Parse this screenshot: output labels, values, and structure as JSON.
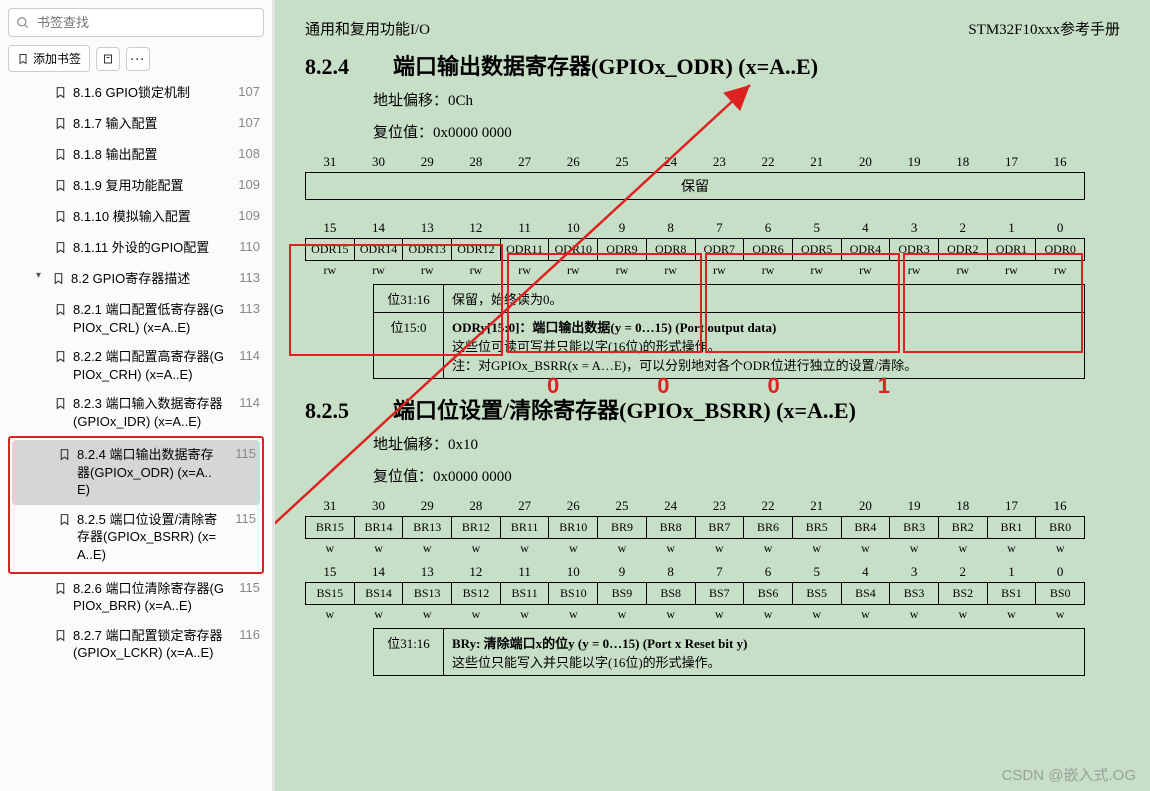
{
  "sidebar": {
    "search_placeholder": "书签查找",
    "add_bookmark": "添加书签",
    "items": [
      {
        "label": "8.1.6 GPIO锁定机制",
        "page": "107",
        "indent": 2
      },
      {
        "label": "8.1.7 输入配置",
        "page": "107",
        "indent": 2
      },
      {
        "label": "8.1.8 输出配置",
        "page": "108",
        "indent": 2
      },
      {
        "label": "8.1.9 复用功能配置",
        "page": "109",
        "indent": 2
      },
      {
        "label": "8.1.10 模拟输入配置",
        "page": "109",
        "indent": 2
      },
      {
        "label": "8.1.11 外设的GPIO配置",
        "page": "110",
        "indent": 2
      },
      {
        "label": "8.2 GPIO寄存器描述",
        "page": "113",
        "indent": 1,
        "caret": "▾"
      },
      {
        "label": "8.2.1 端口配置低寄存器(GPIOx_CRL) (x=A..E)",
        "page": "113",
        "indent": 2
      },
      {
        "label": "8.2.2 端口配置高寄存器(GPIOx_CRH) (x=A..E)",
        "page": "114",
        "indent": 2
      },
      {
        "label": "8.2.3 端口输入数据寄存器(GPIOx_IDR) (x=A..E)",
        "page": "114",
        "indent": 2
      },
      {
        "label": "8.2.4 端口输出数据寄存器(GPIOx_ODR) (x=A..E)",
        "page": "115",
        "indent": 2,
        "active": true
      },
      {
        "label": "8.2.5 端口位设置/清除寄存器(GPIOx_BSRR) (x=A..E)",
        "page": "115",
        "indent": 2
      },
      {
        "label": "8.2.6 端口位清除寄存器(GPIOx_BRR) (x=A..E)",
        "page": "115",
        "indent": 2
      },
      {
        "label": "8.2.7 端口配置锁定寄存器(GPIOx_LCKR) (x=A..E)",
        "page": "116",
        "indent": 2
      }
    ]
  },
  "page": {
    "header_left": "通用和复用功能I/O",
    "header_right": "STM32F10xxx参考手册",
    "sec824": {
      "title": "8.2.4　　端口输出数据寄存器(GPIOx_ODR) (x=A..E)",
      "offset": "地址偏移：0Ch",
      "reset": "复位值：0x0000 0000",
      "hi_nums": [
        "31",
        "30",
        "29",
        "28",
        "27",
        "26",
        "25",
        "24",
        "23",
        "22",
        "21",
        "20",
        "19",
        "18",
        "17",
        "16"
      ],
      "reserved": "保留",
      "lo_nums": [
        "15",
        "14",
        "13",
        "12",
        "11",
        "10",
        "9",
        "8",
        "7",
        "6",
        "5",
        "4",
        "3",
        "2",
        "1",
        "0"
      ],
      "odr": [
        "ODR15",
        "ODR14",
        "ODR13",
        "ODR12",
        "ODR11",
        "ODR10",
        "ODR9",
        "ODR8",
        "ODR7",
        "ODR6",
        "ODR5",
        "ODR4",
        "ODR3",
        "ODR2",
        "ODR1",
        "ODR0"
      ],
      "rw": "rw",
      "d1": {
        "k": "位31:16",
        "v": "保留，始终读为0。"
      },
      "d2": {
        "k": "位15:0",
        "line1": "ODRy[15:0]：端口输出数据(y = 0…15) (Port output data)",
        "line2": "这些位可读可写并只能以字(16位)的形式操作。",
        "line3": "注：对GPIOx_BSRR(x = A…E)，可以分别地对各个ODR位进行独立的设置/清除。"
      }
    },
    "sec825": {
      "title": "8.2.5　　端口位设置/清除寄存器(GPIOx_BSRR) (x=A..E)",
      "offset": "地址偏移：0x10",
      "reset": "复位值：0x0000 0000",
      "hi_nums": [
        "31",
        "30",
        "29",
        "28",
        "27",
        "26",
        "25",
        "24",
        "23",
        "22",
        "21",
        "20",
        "19",
        "18",
        "17",
        "16"
      ],
      "br": [
        "BR15",
        "BR14",
        "BR13",
        "BR12",
        "BR11",
        "BR10",
        "BR9",
        "BR8",
        "BR7",
        "BR6",
        "BR5",
        "BR4",
        "BR3",
        "BR2",
        "BR1",
        "BR0"
      ],
      "lo_nums": [
        "15",
        "14",
        "13",
        "12",
        "11",
        "10",
        "9",
        "8",
        "7",
        "6",
        "5",
        "4",
        "3",
        "2",
        "1",
        "0"
      ],
      "bs": [
        "BS15",
        "BS14",
        "BS13",
        "BS12",
        "BS11",
        "BS10",
        "BS9",
        "BS8",
        "BS7",
        "BS6",
        "BS5",
        "BS4",
        "BS3",
        "BS2",
        "BS1",
        "BS0"
      ],
      "w": "w",
      "d1": {
        "k": "位31:16",
        "line1": "BRy: 清除端口x的位y (y = 0…15) (Port x Reset bit y)",
        "line2": "这些位只能写入并只能以字(16位)的形式操作。"
      }
    },
    "digits": "0　0　0　1",
    "watermark": "CSDN @嵌入式.OG"
  }
}
